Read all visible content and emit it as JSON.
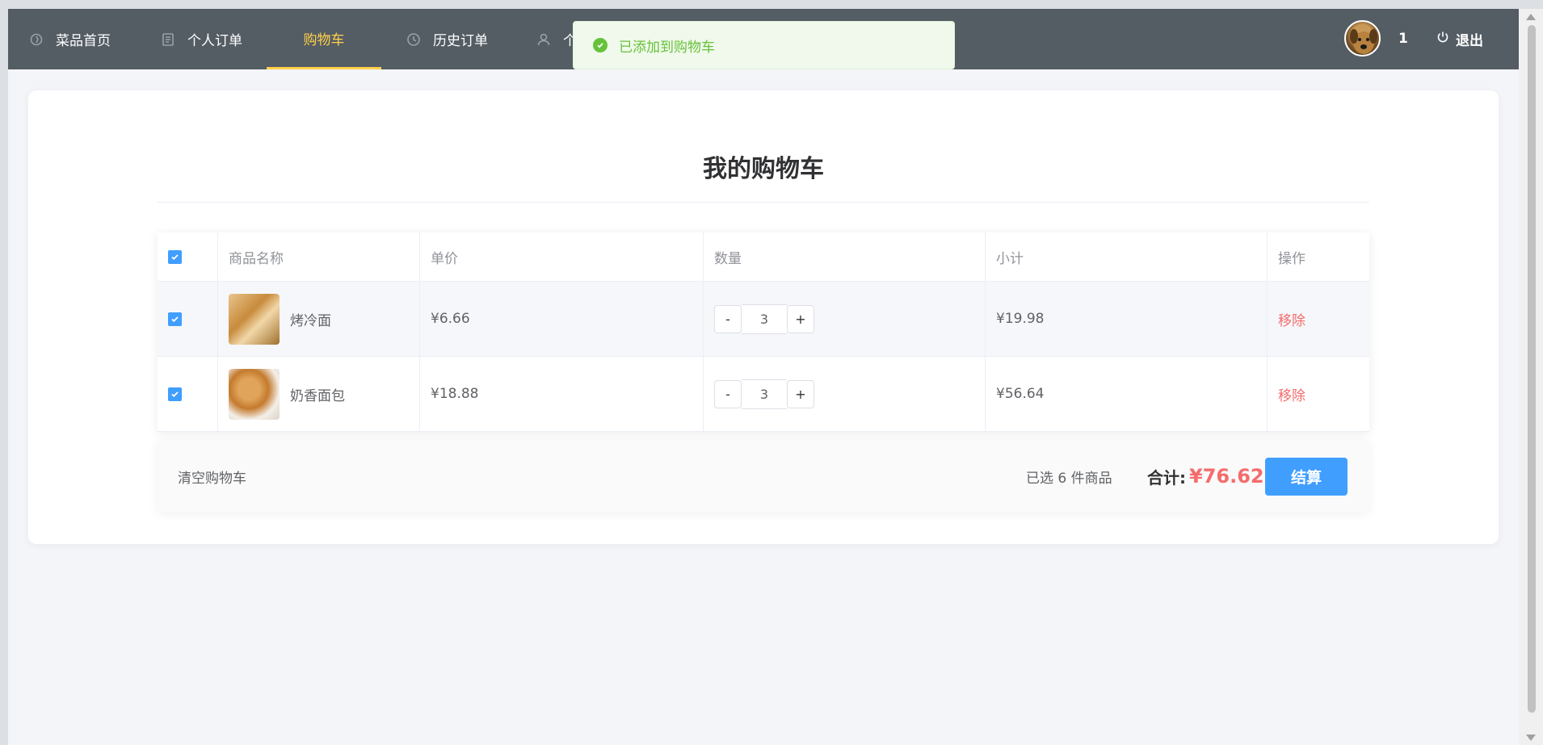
{
  "nav": {
    "items": [
      {
        "label": "菜品首页",
        "icon": "compass-icon",
        "active": false
      },
      {
        "label": "个人订单",
        "icon": "document-icon",
        "active": false
      },
      {
        "label": "购物车",
        "icon": "",
        "active": true
      },
      {
        "label": "历史订单",
        "icon": "clock-icon",
        "active": false
      },
      {
        "label": "个",
        "icon": "user-icon",
        "active": false
      }
    ],
    "user_name": "1",
    "logout_label": "退出"
  },
  "toast": {
    "message": "已添加到购物车"
  },
  "cart": {
    "title": "我的购物车",
    "columns": {
      "name": "商品名称",
      "price": "单价",
      "qty": "数量",
      "subtotal": "小计",
      "op": "操作"
    },
    "rows": [
      {
        "name": "烤冷面",
        "price": "¥6.66",
        "qty": "3",
        "subtotal": "¥19.98",
        "op": "移除",
        "checked": true
      },
      {
        "name": "奶香面包",
        "price": "¥18.88",
        "qty": "3",
        "subtotal": "¥56.64",
        "op": "移除",
        "checked": true
      }
    ],
    "minus": "-",
    "plus": "+",
    "clear_label": "清空购物车",
    "selected_text": "已选 6 件商品",
    "total_label": "合计:",
    "total_value": "¥76.62",
    "checkout_label": "结算"
  },
  "colors": {
    "nav_bg": "#545c64",
    "active": "#ffd04b",
    "primary": "#409eff",
    "danger": "#f56c6c",
    "success": "#67c23a"
  }
}
